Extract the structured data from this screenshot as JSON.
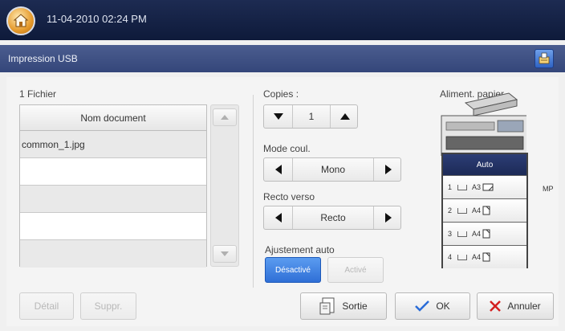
{
  "header": {
    "datetime": "11-04-2010 02:24 PM"
  },
  "titlebar": {
    "title": "Impression USB"
  },
  "files": {
    "count_label": "1  Fichier",
    "column_header": "Nom document",
    "rows": [
      "common_1.jpg",
      "",
      "",
      "",
      ""
    ]
  },
  "copies": {
    "label": "Copies :",
    "value": "1"
  },
  "color_mode": {
    "label": "Mode coul.",
    "value": "Mono"
  },
  "duplex": {
    "label": "Recto verso",
    "value": "Recto"
  },
  "auto_fit": {
    "label": "Ajustement auto",
    "off_label": "Désactivé",
    "on_label": "Activé"
  },
  "paper": {
    "label": "Aliment. papier",
    "auto_label": "Auto",
    "trays": [
      {
        "num": "1",
        "size": "A3"
      },
      {
        "num": "2",
        "size": "A4"
      },
      {
        "num": "3",
        "size": "A4"
      },
      {
        "num": "4",
        "size": "A4"
      }
    ],
    "mp_label": "MP"
  },
  "buttons": {
    "detail": "Détail",
    "delete": "Suppr.",
    "exit": "Sortie",
    "ok": "OK",
    "cancel": "Annuler"
  },
  "colors": {
    "accent": "#2f6fd6",
    "header": "#0e1a3a",
    "cancel_x": "#d42020",
    "ok_check": "#2a6cd8"
  }
}
